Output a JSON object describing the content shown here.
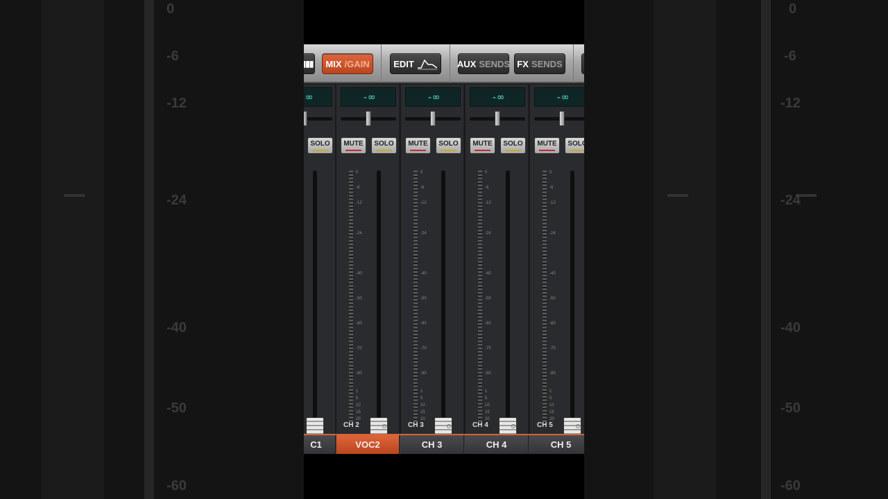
{
  "toolbar": {
    "mix_label": "MIX",
    "gain_label": "/GAIN",
    "edit_label": "EDIT",
    "aux_label": "AUX",
    "aux_sends_label": "SENDS",
    "fx_label": "FX",
    "fx_sends_label": "SENDS"
  },
  "strips": [
    {
      "level": "-∞",
      "mute": "MUTE",
      "solo": "SOLO",
      "name": "CH 2"
    },
    {
      "level": "-∞",
      "mute": "MUTE",
      "solo": "SOLO",
      "name": "CH 3"
    },
    {
      "level": "-∞",
      "mute": "MUTE",
      "solo": "SOLO",
      "name": "CH 4"
    },
    {
      "level": "-∞",
      "mute": "MUTE",
      "solo": "SOLO",
      "name": "CH 5"
    }
  ],
  "partial_strip": {
    "level": "∞",
    "solo": "SOLO"
  },
  "meter_scale": [
    "0",
    "-6",
    "-12",
    "-24",
    "-40",
    "-50",
    "-60",
    "-70",
    "-80",
    "1",
    "5",
    "10",
    "15",
    "20"
  ],
  "tabs": [
    {
      "label": "C1"
    },
    {
      "label": "VOC2",
      "active": true
    },
    {
      "label": "CH 3"
    },
    {
      "label": "CH 4"
    },
    {
      "label": "CH 5"
    }
  ],
  "background_scale": [
    "0",
    "-6",
    "-12",
    "-24",
    "-40",
    "-50",
    "-60"
  ],
  "colors": {
    "accent": "#d2643a",
    "lcd_text": "#4fd1c5",
    "mute_line": "#c0283a",
    "solo_line": "#c8a82a"
  }
}
